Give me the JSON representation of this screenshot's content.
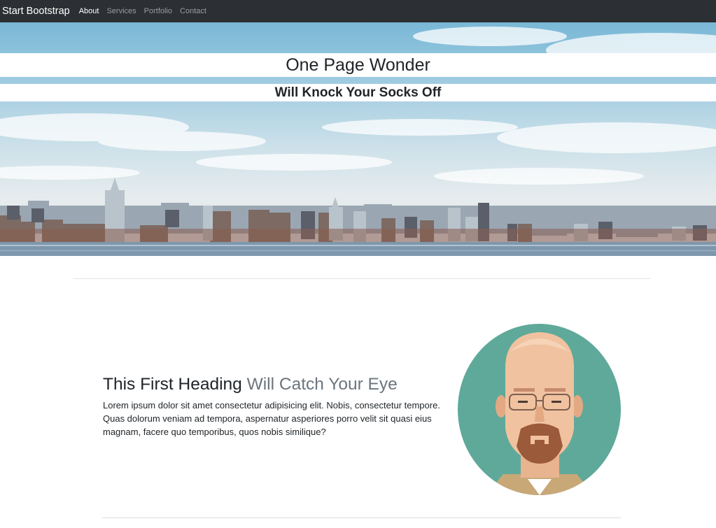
{
  "navbar": {
    "brand": "Start Bootstrap",
    "links": [
      {
        "label": "About",
        "active": true
      },
      {
        "label": "Services",
        "active": false
      },
      {
        "label": "Portfolio",
        "active": false
      },
      {
        "label": "Contact",
        "active": false
      }
    ]
  },
  "hero": {
    "title": "One Page Wonder",
    "subtitle": "Will Knock Your Socks Off",
    "image": "city-skyline-image"
  },
  "section": {
    "heading_main": "This First Heading",
    "heading_muted": "Will Catch Your Eye",
    "body": "Lorem ipsum dolor sit amet consectetur adipisicing elit. Nobis, consectetur tempore. Quas dolorum veniam ad tempora, aspernatur asperiores porro velit sit quasi eius magnam, facere quo temporibus, quos nobis similique?",
    "image": "portrait-illustration"
  },
  "colors": {
    "navbar_bg": "#2c2f33",
    "muted_text": "#6c757d"
  }
}
